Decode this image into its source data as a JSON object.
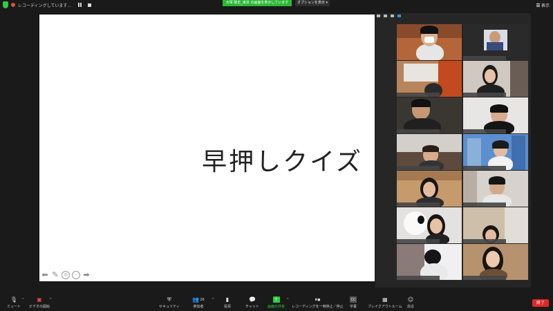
{
  "topbar": {
    "recording_label": "レコーディングしています...",
    "share_banner": "大塚 隆史_東京 の画面を表示しています",
    "options_label": "オプションを表示",
    "view_label": "表示"
  },
  "slide": {
    "title": "早押しクイズ"
  },
  "participants": {
    "count": "26"
  },
  "toolbar": {
    "mute": "ミュート",
    "video": "ビデオの開始",
    "security": "セキュリティ",
    "participants": "参加者",
    "polls": "投票",
    "chat": "チャット",
    "share": "画面の共有",
    "record": "レコーディングを一時停止／停止",
    "captions": "字幕",
    "breakout": "ブレイクアウトルーム",
    "reactions": "反応",
    "end": "終了"
  },
  "colors": {
    "share_green": "#2ab935",
    "end_red": "#e02828",
    "panel_bg": "#262626",
    "slide_bg": "#ffffff"
  }
}
